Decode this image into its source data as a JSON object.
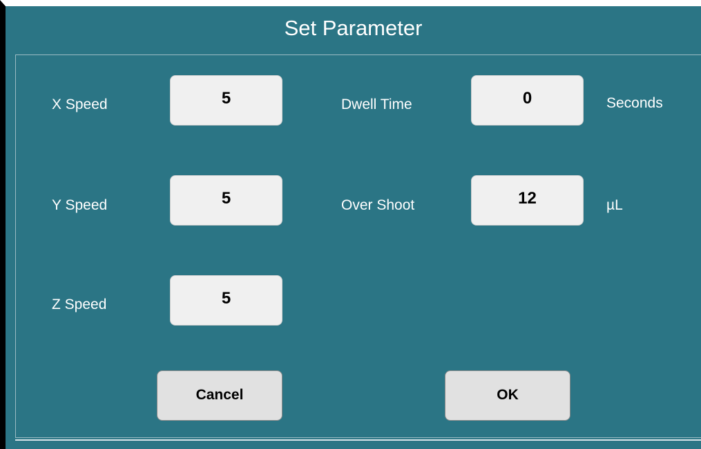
{
  "dialog": {
    "title": "Set Parameter"
  },
  "fields": {
    "x_speed": {
      "label": "X Speed",
      "value": "5"
    },
    "y_speed": {
      "label": "Y Speed",
      "value": "5"
    },
    "z_speed": {
      "label": "Z Speed",
      "value": "5"
    },
    "dwell_time": {
      "label": "Dwell Time",
      "value": "0",
      "unit": "Seconds"
    },
    "over_shoot": {
      "label": "Over Shoot",
      "value": "12",
      "unit": "µL"
    }
  },
  "buttons": {
    "cancel": "Cancel",
    "ok": "OK"
  },
  "colors": {
    "background": "#2b7585",
    "field_background": "#f0f0f0",
    "button_background": "#e1e1e1",
    "text": "#ffffff"
  }
}
